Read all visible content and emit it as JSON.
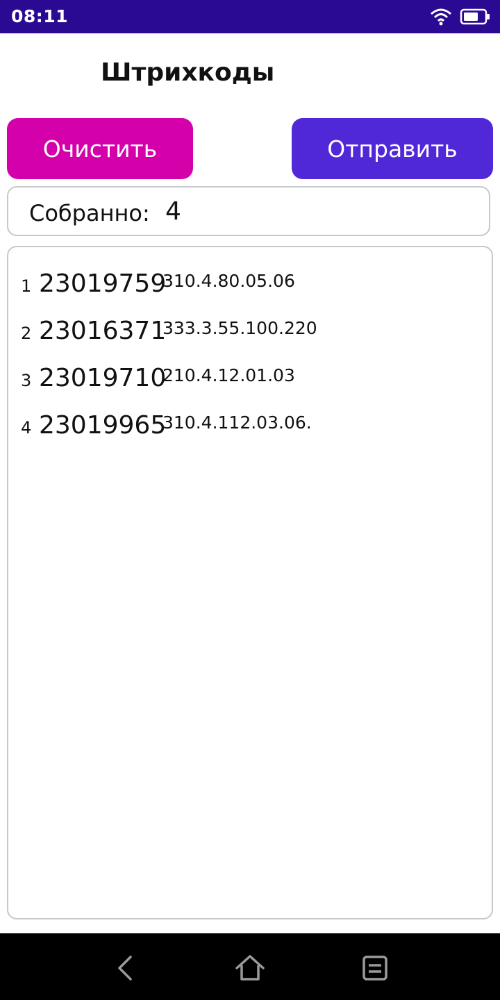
{
  "status_bar": {
    "time": "08:11",
    "icons": [
      "wifi-icon",
      "battery-icon"
    ]
  },
  "header": {
    "title": "Штрихкоды"
  },
  "actions": {
    "clear_label": "Очистить",
    "send_label": "Отправить",
    "clear_color": "#d400aa",
    "send_color": "#5028d8"
  },
  "counter": {
    "label": "Собранно:",
    "value": "4"
  },
  "items": [
    {
      "index": "1",
      "code": "23019759",
      "detail": "310.4.80.05.06"
    },
    {
      "index": "2",
      "code": "23016371",
      "detail": "333.3.55.100.220"
    },
    {
      "index": "3",
      "code": "23019710",
      "detail": "210.4.12.01.03"
    },
    {
      "index": "4",
      "code": "23019965",
      "detail": "310.4.112.03.06."
    }
  ],
  "nav_bar": {
    "icons": [
      "back-icon",
      "home-icon",
      "menu-icon"
    ]
  }
}
